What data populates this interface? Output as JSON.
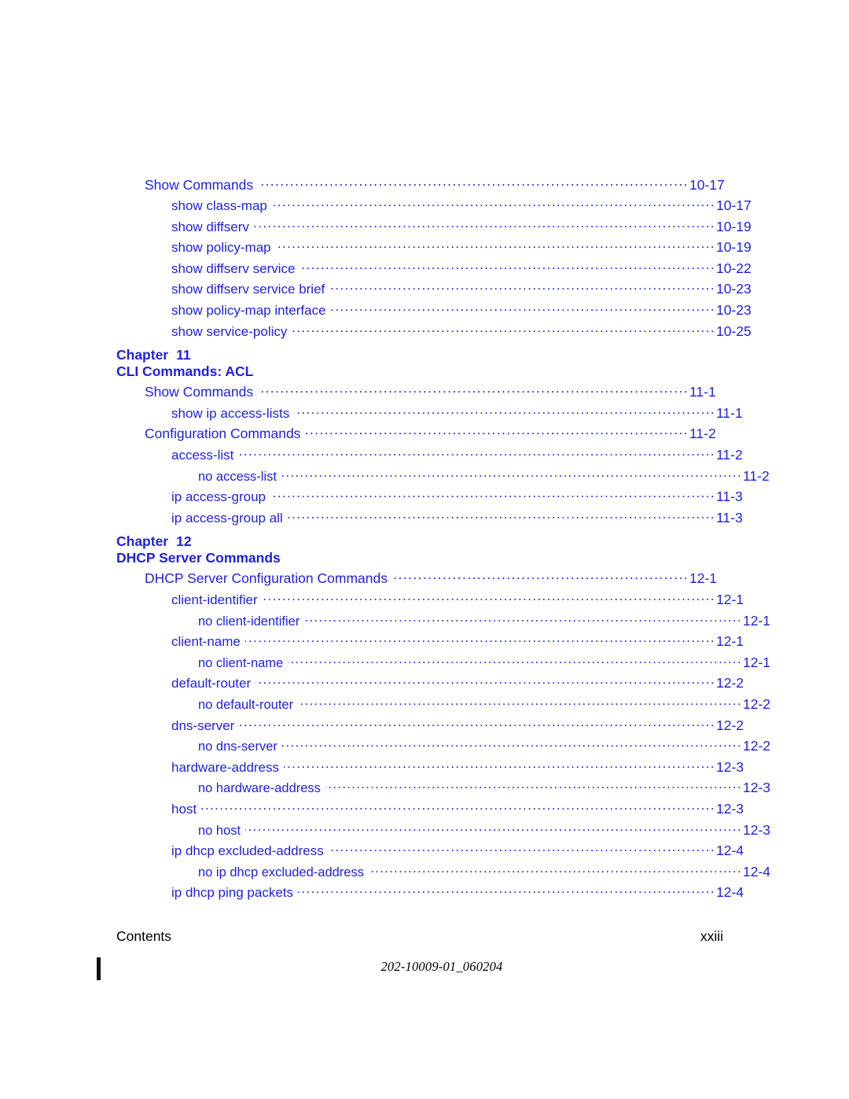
{
  "document": {
    "blue": "#1f1fe0",
    "black": "#000000"
  },
  "toc": {
    "blocks": [
      {
        "type": "entries",
        "entries": [
          {
            "level": 1,
            "label": "Show Commands",
            "page": "10-17"
          },
          {
            "level": 2,
            "label": "show class-map",
            "page": "10-17"
          },
          {
            "level": 2,
            "label": "show diffserv",
            "page": "10-19"
          },
          {
            "level": 2,
            "label": "show policy-map",
            "page": "10-19"
          },
          {
            "level": 2,
            "label": "show diffserv service",
            "page": "10-22"
          },
          {
            "level": 2,
            "label": "show diffserv service brief",
            "page": "10-23"
          },
          {
            "level": 2,
            "label": "show policy-map interface",
            "page": "10-23"
          },
          {
            "level": 2,
            "label": "show service-policy",
            "page": "10-25"
          }
        ]
      },
      {
        "type": "chapter",
        "chapter_word": "Chapter",
        "chapter_number": "11",
        "chapter_title": "CLI Commands: ACL",
        "entries": [
          {
            "level": 1,
            "label": "Show Commands",
            "page": "11-1"
          },
          {
            "level": 2,
            "label": "show ip access-lists",
            "page": "11-1"
          },
          {
            "level": 1,
            "label": "Configuration Commands",
            "page": "11-2"
          },
          {
            "level": 2,
            "label": "access-list",
            "page": "11-2"
          },
          {
            "level": 3,
            "label": "no access-list",
            "page": "11-2"
          },
          {
            "level": 2,
            "label": "ip access-group",
            "page": "11-3"
          },
          {
            "level": 2,
            "label": "ip access-group all",
            "page": "11-3"
          }
        ]
      },
      {
        "type": "chapter",
        "chapter_word": "Chapter",
        "chapter_number": "12",
        "chapter_title": "DHCP Server Commands",
        "entries": [
          {
            "level": 1,
            "label": "DHCP Server Configuration Commands",
            "page": "12-1"
          },
          {
            "level": 2,
            "label": "client-identifier",
            "page": "12-1"
          },
          {
            "level": 3,
            "label": "no client-identifier",
            "page": "12-1"
          },
          {
            "level": 2,
            "label": "client-name",
            "page": "12-1"
          },
          {
            "level": 3,
            "label": "no client-name",
            "page": "12-1"
          },
          {
            "level": 2,
            "label": "default-router",
            "page": "12-2"
          },
          {
            "level": 3,
            "label": "no default-router",
            "page": "12-2"
          },
          {
            "level": 2,
            "label": "dns-server",
            "page": "12-2"
          },
          {
            "level": 3,
            "label": "no dns-server",
            "page": "12-2"
          },
          {
            "level": 2,
            "label": "hardware-address",
            "page": "12-3"
          },
          {
            "level": 3,
            "label": "no hardware-address",
            "page": "12-3"
          },
          {
            "level": 2,
            "label": "host",
            "page": "12-3"
          },
          {
            "level": 3,
            "label": "no host",
            "page": "12-3"
          },
          {
            "level": 2,
            "label": "ip dhcp excluded-address",
            "page": "12-4"
          },
          {
            "level": 3,
            "label": "no ip dhcp excluded-address",
            "page": "12-4"
          },
          {
            "level": 2,
            "label": "ip dhcp ping packets",
            "page": "12-4"
          }
        ]
      }
    ]
  },
  "footer": {
    "section_label": "Contents",
    "page_number": "xxiii",
    "document_number": "202-10009-01_060204"
  }
}
